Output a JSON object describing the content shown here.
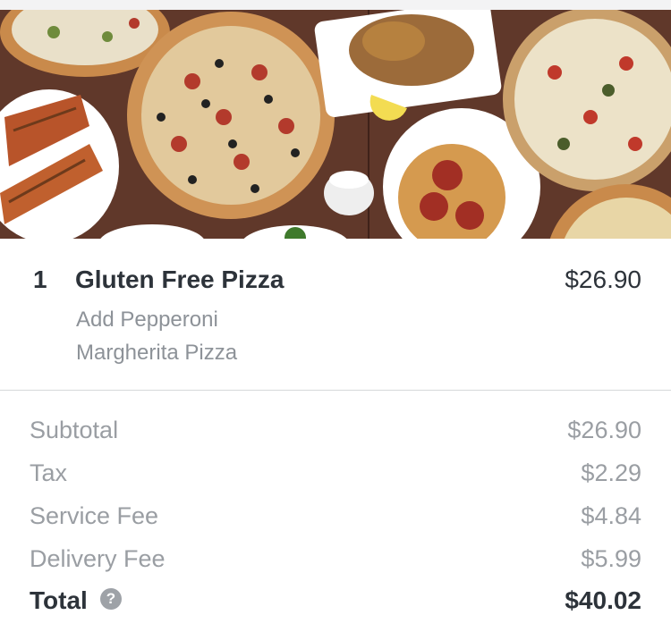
{
  "order_item": {
    "quantity": "1",
    "name": "Gluten Free Pizza",
    "price": "$26.90",
    "modifiers": [
      "Add Pepperoni",
      "Margherita Pizza"
    ]
  },
  "summary": {
    "rows": [
      {
        "label": "Subtotal",
        "value": "$26.90"
      },
      {
        "label": "Tax",
        "value": "$2.29"
      },
      {
        "label": "Service Fee",
        "value": "$4.84"
      },
      {
        "label": "Delivery Fee",
        "value": "$5.99"
      }
    ],
    "total": {
      "label": "Total",
      "value": "$40.02",
      "help_icon": "question-circle-icon"
    }
  },
  "colors": {
    "text_dark": "#2d333a",
    "text_muted": "#9a9ea3",
    "divider": "#d6d8da",
    "table_wood": "#5b3528"
  }
}
